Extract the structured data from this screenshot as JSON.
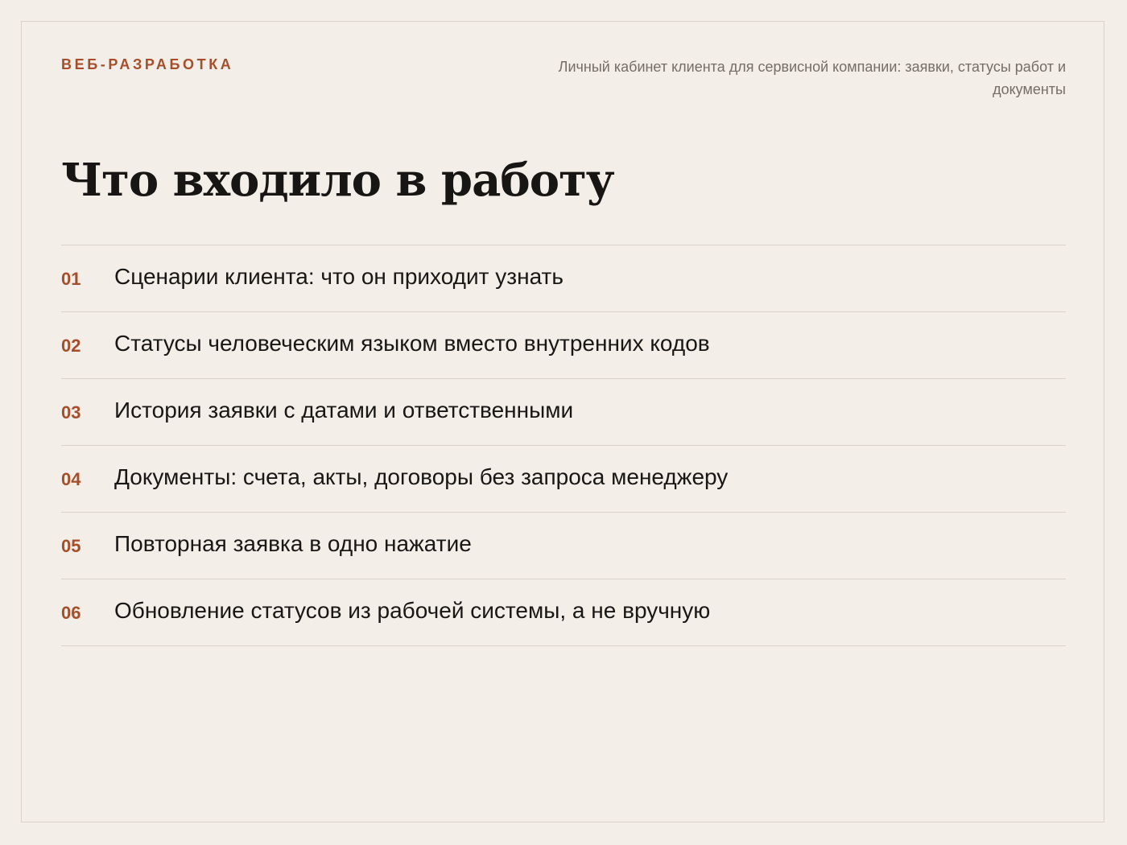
{
  "header": {
    "eyebrow": "ВЕБ-РАЗРАБОТКА",
    "subtitle": "Личный кабинет клиента для сервисной компании: заявки, статусы работ и документы"
  },
  "main": {
    "title": "Что входило в работу",
    "items": [
      {
        "number": "01",
        "text": "Сценарии клиента: что он приходит узнать"
      },
      {
        "number": "02",
        "text": "Статусы человеческим языком вместо внутренних кодов"
      },
      {
        "number": "03",
        "text": "История заявки с датами и ответственными"
      },
      {
        "number": "04",
        "text": "Документы: счета, акты, договоры без запроса менеджеру"
      },
      {
        "number": "05",
        "text": "Повторная заявка в одно нажатие"
      },
      {
        "number": "06",
        "text": "Обновление статусов из рабочей системы, а не вручную"
      }
    ]
  },
  "colors": {
    "background": "#f3eee8",
    "accent": "#a64e2a",
    "text": "#181716",
    "muted": "#756d67",
    "divider": "#d9d2ca"
  }
}
